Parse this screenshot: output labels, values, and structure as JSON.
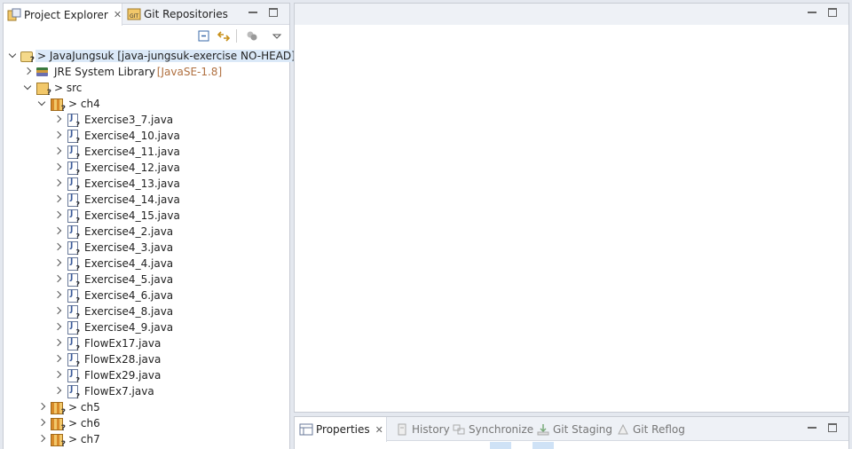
{
  "left_panel": {
    "tabs": [
      {
        "label": "Project Explorer",
        "close": "✕"
      },
      {
        "label": "Git Repositories"
      }
    ]
  },
  "tree": {
    "project": {
      "label": "> JavaJungsuk [java-jungsuk-exercise NO-HEAD]"
    },
    "library": {
      "label": "JRE System Library",
      "decoration": "[JavaSE-1.8]"
    },
    "src": {
      "label": "> src"
    },
    "ch4": {
      "label": "> ch4"
    },
    "files": [
      "Exercise3_7.java",
      "Exercise4_10.java",
      "Exercise4_11.java",
      "Exercise4_12.java",
      "Exercise4_13.java",
      "Exercise4_14.java",
      "Exercise4_15.java",
      "Exercise4_2.java",
      "Exercise4_3.java",
      "Exercise4_4.java",
      "Exercise4_5.java",
      "Exercise4_6.java",
      "Exercise4_8.java",
      "Exercise4_9.java",
      "FlowEx17.java",
      "FlowEx28.java",
      "FlowEx29.java",
      "FlowEx7.java"
    ],
    "packages": [
      "> ch5",
      "> ch6",
      "> ch7"
    ]
  },
  "bottom_panel": {
    "tabs": [
      {
        "label": "Properties",
        "close": "✕"
      },
      {
        "label": "History"
      },
      {
        "label": "Synchronize"
      },
      {
        "label": "Git Staging"
      },
      {
        "label": "Git Reflog"
      }
    ]
  },
  "colors": {
    "background": "#e4e8ef",
    "selection": "#dbe9f8",
    "decoration": "#b07040"
  }
}
